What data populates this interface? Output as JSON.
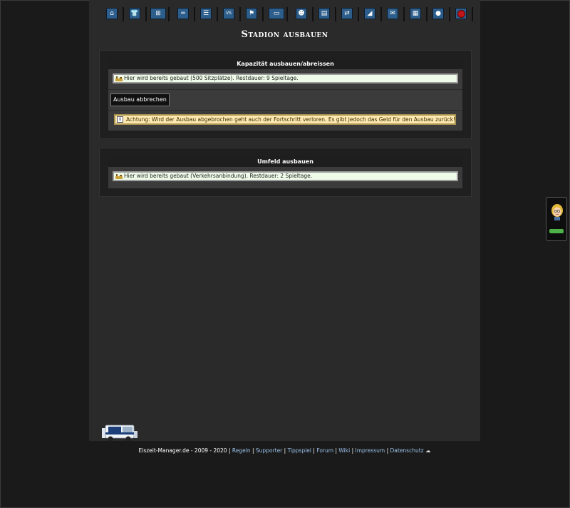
{
  "page": {
    "title": "Stadion ausbauen"
  },
  "nav": {
    "items": [
      {
        "name": "home-icon",
        "glyph": "⌂"
      },
      {
        "name": "jersey-icon",
        "glyph": "👕"
      },
      {
        "name": "tactics-icon",
        "glyph": "⊞"
      },
      {
        "name": "training-icon",
        "glyph": "═"
      },
      {
        "name": "list-icon",
        "glyph": "☰"
      },
      {
        "name": "versus-icon",
        "glyph": "VS"
      },
      {
        "name": "league-icon",
        "glyph": "⚑"
      },
      {
        "name": "arena-icon",
        "glyph": "▭"
      },
      {
        "name": "coach-icon",
        "glyph": "☻"
      },
      {
        "name": "finances-icon",
        "glyph": "▤"
      },
      {
        "name": "transfer-icon",
        "glyph": "⇄"
      },
      {
        "name": "statistics-icon",
        "glyph": "◢"
      },
      {
        "name": "mail-icon",
        "glyph": "✉"
      },
      {
        "name": "news-icon",
        "glyph": "▦"
      },
      {
        "name": "chat-icon",
        "glyph": "●"
      },
      {
        "name": "logout-icon",
        "glyph": ""
      }
    ]
  },
  "capacity_panel": {
    "heading": "Kapazität ausbauen/abreissen",
    "status": "Hier wird bereits gebaut (500 Sitzplätze). Restdauer: 9 Spieltage.",
    "cancel_button": "Ausbau abbrechen",
    "warning": "Achtung: Wird der Ausbau abgebrochen geht auch der Fortschritt verloren. Es gibt jedoch das Geld für den Ausbau zurück!"
  },
  "surroundings_panel": {
    "heading": "Umfeld ausbauen",
    "status": "Hier wird bereits gebaut (Verkehrsanbindung). Restdauer: 2 Spieltage."
  },
  "footer": {
    "copyright": "Eiszeit-Manager.de - 2009 - 2020",
    "links": [
      "Regeln",
      "Supporter",
      "Tippspiel",
      "Forum",
      "Wiki",
      "Impressum",
      "Datenschutz"
    ]
  },
  "colors": {
    "background": "#1a1a1a",
    "content_column": "#2a2a2a",
    "nav_icon": "#2d5d8a",
    "link": "#9bc1ea",
    "info_box": "#eefbe8",
    "warning_box": "#fde9b1"
  }
}
